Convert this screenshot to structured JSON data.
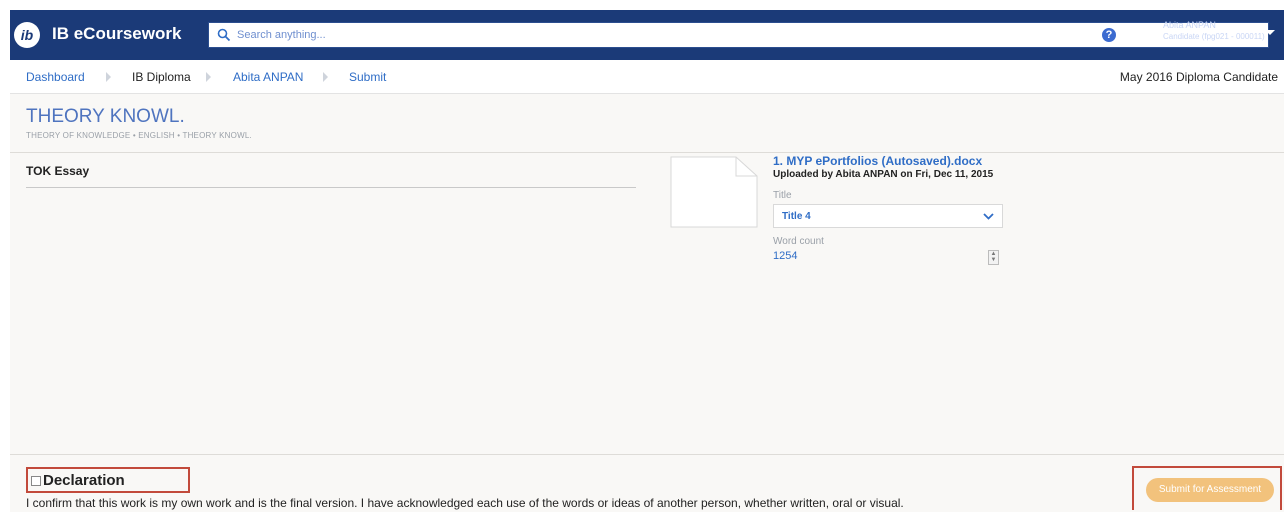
{
  "app": {
    "name": "IB eCoursework"
  },
  "search": {
    "placeholder": "Search anything..."
  },
  "header": {
    "help_label": "?",
    "user_name": "Abita ANPAN",
    "user_sub": "Candidate (fpg021 - 000011)"
  },
  "breadcrumb": {
    "items": [
      "Dashboard",
      "IB Diploma",
      "Abita ANPAN",
      "Submit"
    ],
    "candidate": "May 2016 Diploma Candidate"
  },
  "course": {
    "title": "THEORY KNOWL.",
    "subtitle": "THEORY OF KNOWLEDGE • ENGLISH • THEORY KNOWL."
  },
  "section": {
    "title": "TOK Essay"
  },
  "file": {
    "name": "1. MYP ePortfolios (Autosaved).docx",
    "meta": "Uploaded by Abita ANPAN on Fri, Dec 11, 2015",
    "title_label": "Title",
    "title_value": "Title 4",
    "word_count_label": "Word count",
    "word_count_value": "1254"
  },
  "declaration": {
    "label": "Declaration",
    "text": "I confirm that this work is my own work and is the final version. I have acknowledged each use of the words or ideas of another person, whether written, oral or visual."
  },
  "actions": {
    "submit_label": "Submit for Assessment"
  },
  "colors": {
    "brand": "#1b3a78",
    "link": "#2f6dc6",
    "highlight": "#c24a3b",
    "submit": "#f2c27c"
  }
}
